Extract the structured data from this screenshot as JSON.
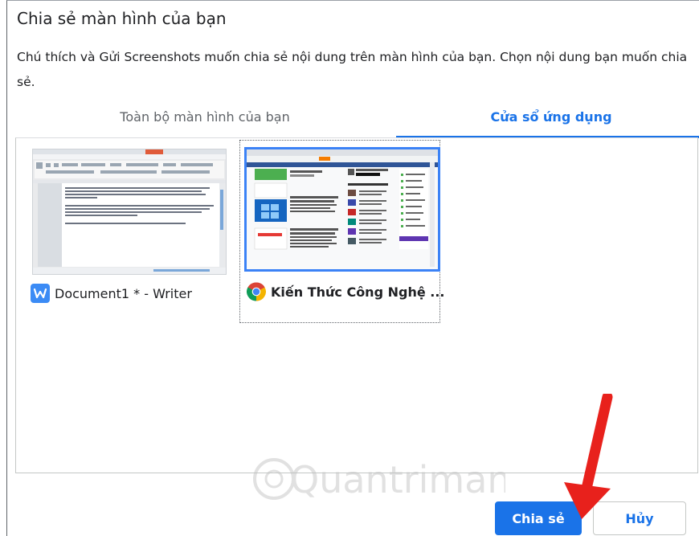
{
  "dialog": {
    "title": "Chia sẻ màn hình của bạn",
    "description": "Chú thích và Gửi Screenshots muốn chia sẻ nội dung trên màn hình của bạn. Chọn nội dung bạn muốn chia sẻ."
  },
  "tabs": [
    {
      "label": "Toàn bộ màn hình của bạn",
      "selected": false
    },
    {
      "label": "Cửa sổ ứng dụng",
      "selected": true
    }
  ],
  "sources": [
    {
      "label": "Document1 * - Writer",
      "icon": "writer-icon",
      "selected": false
    },
    {
      "label": "Kiến Thức Công Nghệ ...",
      "icon": "chrome-icon",
      "selected": true
    }
  ],
  "buttons": {
    "share": "Chia sẻ",
    "cancel": "Hủy"
  },
  "colors": {
    "accent": "#1a73e8",
    "arrow": "#e8211c"
  },
  "watermark": "Quantrimang"
}
